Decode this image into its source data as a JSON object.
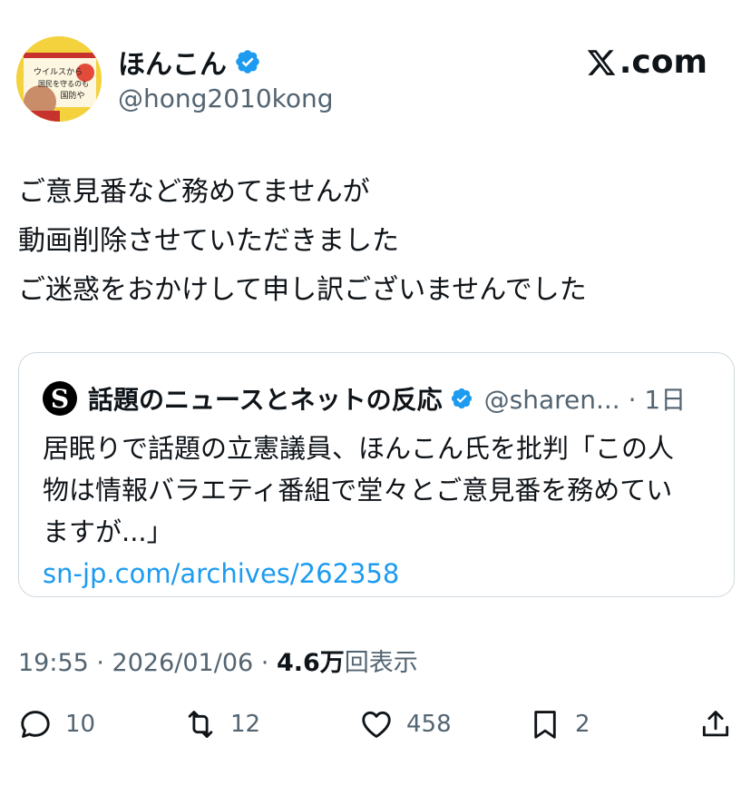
{
  "author": {
    "display_name": "ほんこん",
    "handle": "@hong2010kong",
    "avatar_book_lines": [
      "ウイルスから",
      "国民を守るのも",
      "国防や"
    ]
  },
  "brand": {
    "label": ".com"
  },
  "tweet": {
    "lines": [
      "ご意見番など務めてませんが",
      "動画削除させていただきました",
      "ご迷惑をおかけして申し訳ございませんでした"
    ]
  },
  "quote": {
    "logo_letter": "S",
    "name": "話題のニュースとネットの反応",
    "handle_time": "@sharen... · 1日",
    "lines": [
      "居眠りで話題の立憲議員、ほんこん氏を批判「この人",
      "物は情報バラエティ番組で堂々とご意見番を務めてい",
      "ますが...」"
    ],
    "link": "sn-jp.com/archives/262358"
  },
  "meta": {
    "time_date": "19:55 · 2026/01/06 · ",
    "views_count": "4.6万",
    "views_label": "回表示"
  },
  "actions": {
    "replies": "10",
    "reposts": "12",
    "likes": "458",
    "bookmarks": "2"
  },
  "colors": {
    "accent": "#1d9bf0",
    "secondary_text": "#536471",
    "border": "#cfd9de"
  },
  "icons": [
    "verified-badge-icon",
    "x-logo-icon",
    "reply-icon",
    "repost-icon",
    "like-icon",
    "bookmark-icon",
    "share-icon"
  ]
}
